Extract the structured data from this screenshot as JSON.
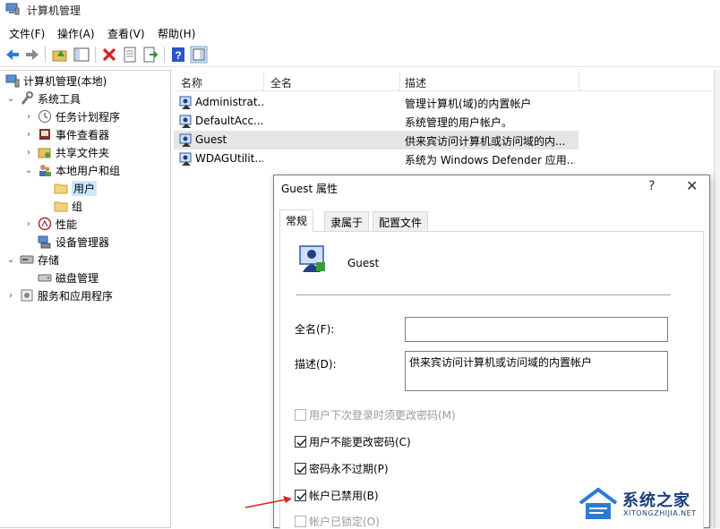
{
  "window": {
    "title": "计算机管理"
  },
  "menu": [
    "文件(F)",
    "操作(A)",
    "查看(V)",
    "帮助(H)"
  ],
  "tree": {
    "root": "计算机管理(本地)",
    "system_tools": "系统工具",
    "task_scheduler": "任务计划程序",
    "event_viewer": "事件查看器",
    "shared_folders": "共享文件夹",
    "local_users": "本地用户和组",
    "users": "用户",
    "groups": "组",
    "performance": "性能",
    "device_manager": "设备管理器",
    "storage": "存储",
    "disk_management": "磁盘管理",
    "services": "服务和应用程序"
  },
  "list": {
    "headers": [
      "名称",
      "全名",
      "描述"
    ],
    "rows": [
      {
        "name": "Administrat...",
        "fullname": "",
        "desc": "管理计算机(域)的内置帐户"
      },
      {
        "name": "DefaultAcc...",
        "fullname": "",
        "desc": "系统管理的用户帐户。"
      },
      {
        "name": "Guest",
        "fullname": "",
        "desc": "供来宾访问计算机或访问域的内..."
      },
      {
        "name": "WDAGUtilit...",
        "fullname": "",
        "desc": "系统为 Windows Defender 应用..."
      }
    ]
  },
  "dialog": {
    "title": "Guest 属性",
    "help": "?",
    "close": "✕",
    "tabs": [
      "常规",
      "隶属于",
      "配置文件"
    ],
    "username": "Guest",
    "fullname_label": "全名(F):",
    "fullname_value": "",
    "desc_label": "描述(D):",
    "desc_value": "供来宾访问计算机或访问域的内置帐户",
    "checkboxes": [
      {
        "label": "用户下次登录时须更改密码(M)",
        "checked": false,
        "disabled": true
      },
      {
        "label": "用户不能更改密码(C)",
        "checked": true,
        "disabled": false
      },
      {
        "label": "密码永不过期(P)",
        "checked": true,
        "disabled": false
      },
      {
        "label": "帐户已禁用(B)",
        "checked": true,
        "disabled": false
      },
      {
        "label": "帐户已锁定(O)",
        "checked": false,
        "disabled": true
      }
    ]
  },
  "watermark": {
    "text": "系统之家",
    "sub": "XITONGZHIJIA.NET"
  },
  "colors": {
    "selection": "#cce8ff",
    "row_highlight": "#e5e5e5",
    "arrow": "#e02020",
    "watermark": "#1c3f7a"
  }
}
